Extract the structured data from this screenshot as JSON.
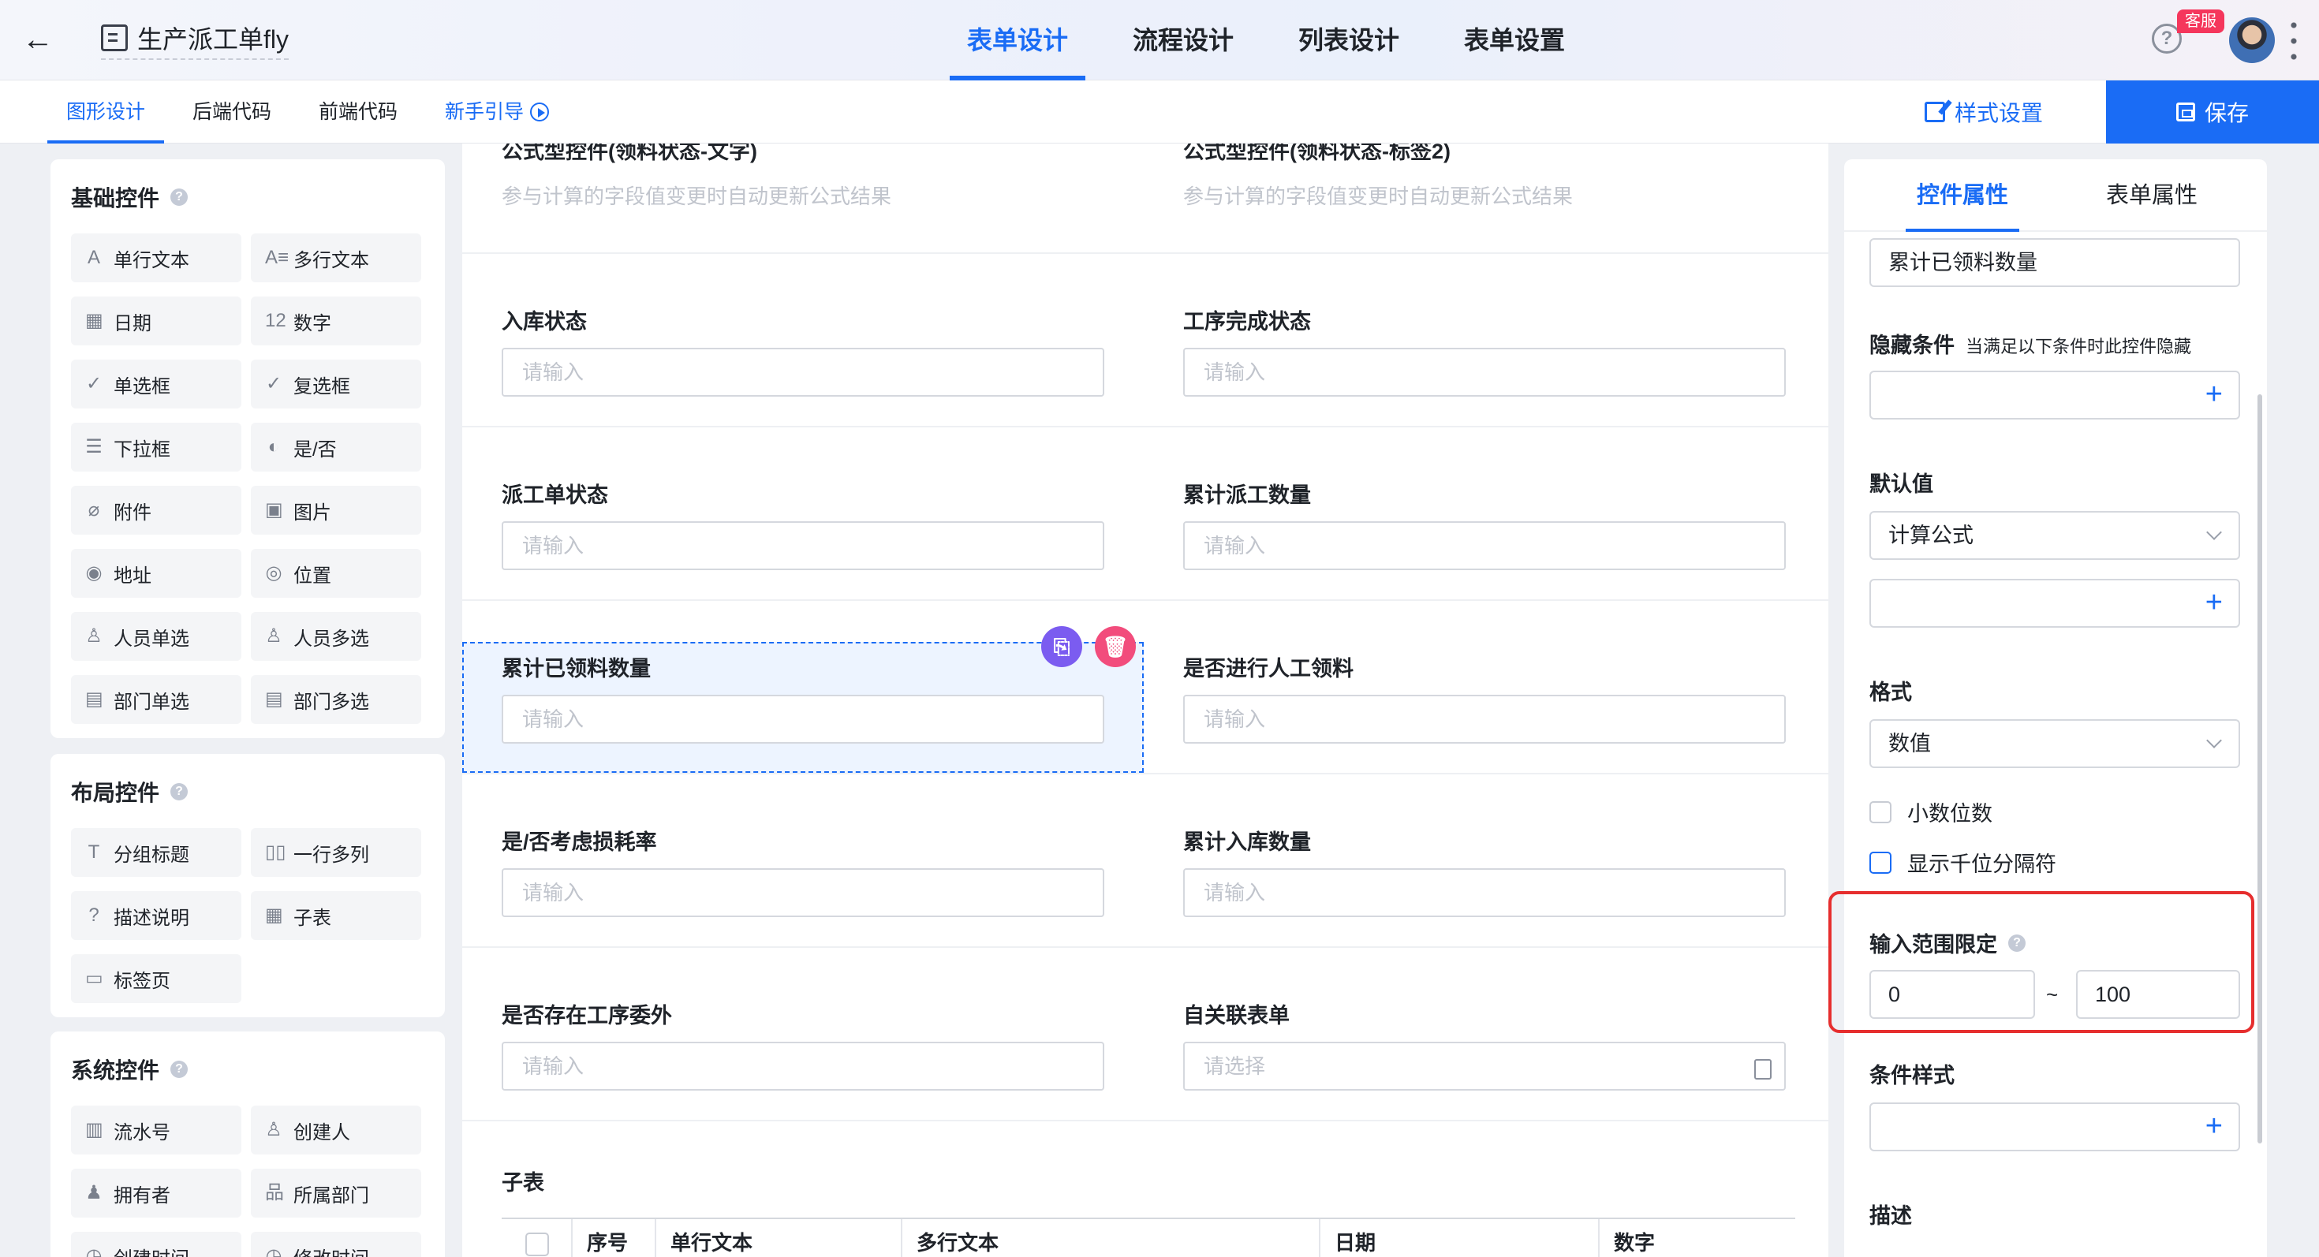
{
  "header": {
    "app_title": "生产派工单fly",
    "tabs": [
      {
        "label": "表单设计",
        "active": true
      },
      {
        "label": "流程设计"
      },
      {
        "label": "列表设计"
      },
      {
        "label": "表单设置"
      }
    ],
    "service_badge": "客服",
    "help_icon": "?"
  },
  "subbar": {
    "tabs": [
      "图形设计",
      "后端代码",
      "前端代码"
    ],
    "guide": "新手引导",
    "style_settings": "样式设置",
    "save": "保存"
  },
  "left": {
    "basic": {
      "title": "基础控件",
      "items": [
        {
          "label": "单行文本",
          "icon": "A"
        },
        {
          "label": "多行文本",
          "icon": "A≡"
        },
        {
          "label": "日期",
          "icon": "▦"
        },
        {
          "label": "数字",
          "icon": "12"
        },
        {
          "label": "单选框",
          "icon": "✓"
        },
        {
          "label": "复选框",
          "icon": "✓"
        },
        {
          "label": "下拉框",
          "icon": "☰"
        },
        {
          "label": "是/否",
          "icon": "◐"
        },
        {
          "label": "附件",
          "icon": "⌀"
        },
        {
          "label": "图片",
          "icon": "▣"
        },
        {
          "label": "地址",
          "icon": "◉"
        },
        {
          "label": "位置",
          "icon": "◎"
        },
        {
          "label": "人员单选",
          "icon": "♙"
        },
        {
          "label": "人员多选",
          "icon": "♙"
        },
        {
          "label": "部门单选",
          "icon": "▤"
        },
        {
          "label": "部门多选",
          "icon": "▤"
        }
      ]
    },
    "layout": {
      "title": "布局控件",
      "items": [
        {
          "label": "分组标题",
          "icon": "T"
        },
        {
          "label": "一行多列",
          "icon": "▯▯"
        },
        {
          "label": "描述说明",
          "icon": "?"
        },
        {
          "label": "子表",
          "icon": "▦"
        },
        {
          "label": "标签页",
          "icon": "▭"
        }
      ]
    },
    "system": {
      "title": "系统控件",
      "items": [
        {
          "label": "流水号",
          "icon": "▥"
        },
        {
          "label": "创建人",
          "icon": "♙"
        },
        {
          "label": "拥有者",
          "icon": "♟"
        },
        {
          "label": "所属部门",
          "icon": "品"
        },
        {
          "label": "创建时间",
          "icon": "◷"
        },
        {
          "label": "修改时间",
          "icon": "◷"
        }
      ]
    }
  },
  "canvas": {
    "top_row": [
      {
        "label": "公式型控件(领料状态-文字)",
        "hint": "参与计算的字段值变更时自动更新公式结果"
      },
      {
        "label": "公式型控件(领料状态-标签2)",
        "hint": "参与计算的字段值变更时自动更新公式结果"
      }
    ],
    "fields": [
      {
        "label": "入库状态",
        "placeholder": "请输入"
      },
      {
        "label": "工序完成状态",
        "placeholder": "请输入"
      },
      {
        "label": "派工单状态",
        "placeholder": "请输入"
      },
      {
        "label": "累计派工数量",
        "placeholder": "请输入"
      },
      {
        "label": "累计已领料数量",
        "placeholder": "请输入"
      },
      {
        "label": "是否进行人工领料",
        "placeholder": "请输入"
      },
      {
        "label": "是/否考虑损耗率",
        "placeholder": "请输入"
      },
      {
        "label": "累计入库数量",
        "placeholder": "请输入"
      },
      {
        "label": "是否存在工序委外",
        "placeholder": "请输入"
      },
      {
        "label": "自关联表单",
        "placeholder": "请选择"
      }
    ],
    "subtable": {
      "title": "子表",
      "columns": [
        "序号",
        "单行文本",
        "多行文本",
        "日期",
        "数字"
      ]
    }
  },
  "right": {
    "tabs": [
      "控件属性",
      "表单属性"
    ],
    "field_name": "累计已领料数量",
    "hide_label": "隐藏条件",
    "hide_hint": "当满足以下条件时此控件隐藏",
    "default_label": "默认值",
    "default_type": "计算公式",
    "format_label": "格式",
    "format_value": "数值",
    "decimal": "小数位数",
    "thousands": "显示千位分隔符",
    "range_label": "输入范围限定",
    "range_min": "0",
    "range_sep": "~",
    "range_max": "100",
    "cond_style": "条件样式",
    "desc": "描述"
  }
}
